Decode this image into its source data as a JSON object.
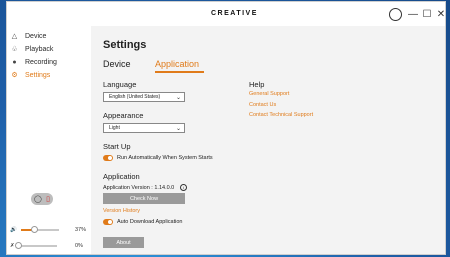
{
  "window": {
    "brand": "CREATIVE"
  },
  "titlebar": {
    "minimize": "—",
    "maximize": "☐",
    "close": "✕"
  },
  "sidebar": {
    "items": [
      {
        "label": "Device",
        "icon": "speaker-icon"
      },
      {
        "label": "Playback",
        "icon": "bell-icon"
      },
      {
        "label": "Recording",
        "icon": "microphone-icon"
      },
      {
        "label": "Settings",
        "icon": "gear-icon",
        "active": true
      }
    ],
    "volume": {
      "percent_label": "37%",
      "level": 0.37
    },
    "mic": {
      "percent_label": "0%",
      "level": 0.0
    }
  },
  "settings": {
    "title": "Settings",
    "tabs": [
      {
        "label": "Device"
      },
      {
        "label": "Application",
        "active": true
      }
    ],
    "language": {
      "label": "Language",
      "value": "English (United States)"
    },
    "appearance": {
      "label": "Appearance",
      "value": "Light"
    },
    "startup": {
      "label": "Start Up",
      "toggle_label": "Run Automatically When System Starts",
      "enabled": true
    },
    "application": {
      "label": "Application",
      "version": "Application Version : 1.14.0.0",
      "check_now": "Check Now",
      "version_history": "Version History",
      "auto_download": "Auto Download Application",
      "auto_download_enabled": true
    },
    "about": "About",
    "help": {
      "label": "Help",
      "links": [
        "General Support",
        "Contact Us",
        "Contact Technical Support"
      ]
    }
  },
  "colors": {
    "accent": "#e07b1a",
    "button": "#9a9a9a"
  }
}
